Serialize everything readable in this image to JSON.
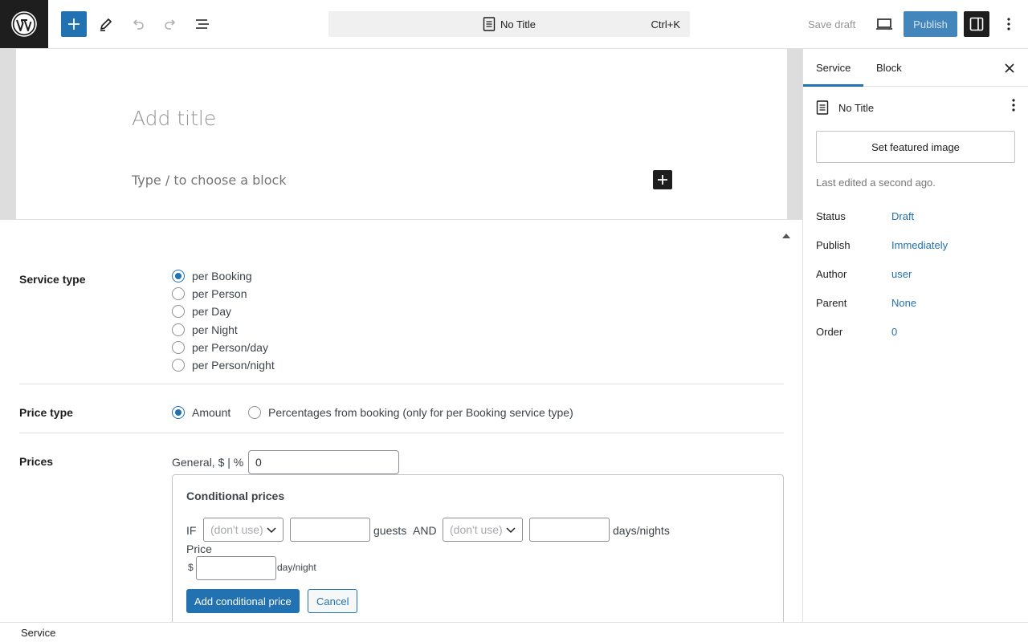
{
  "topbar": {
    "command_title": "No Title",
    "command_shortcut": "Ctrl+K",
    "save_draft": "Save draft",
    "publish": "Publish"
  },
  "editor": {
    "title_placeholder": "Add title",
    "block_placeholder": "Type / to choose a block"
  },
  "meta": {
    "service_type": {
      "label": "Service type",
      "options": [
        "per Booking",
        "per Person",
        "per Day",
        "per Night",
        "per Person/day",
        "per Person/night"
      ],
      "selected": "per Booking"
    },
    "price_type": {
      "label": "Price type",
      "options": [
        "Amount",
        "Percentages from booking (only for per Booking service type)"
      ],
      "selected": "Amount"
    },
    "prices": {
      "label": "Prices",
      "general_label": "General, $ | %",
      "general_value": "0",
      "conditional": {
        "title": "Conditional prices",
        "if_label": "IF",
        "select_1": "(don't use)",
        "guests_label": "guests",
        "and_label": "AND",
        "select_2": "(don't use)",
        "days_label": "days/nights",
        "price_label": "Price",
        "currency": "$",
        "unit_label": "day/night",
        "add_button": "Add conditional price",
        "cancel_button": "Cancel"
      }
    }
  },
  "footer": {
    "breadcrumb": "Service"
  },
  "sidebar": {
    "tabs": [
      "Service",
      "Block"
    ],
    "active_tab": "Service",
    "doc_title": "No Title",
    "featured_image": "Set featured image",
    "last_edited": "Last edited a second ago.",
    "props": [
      {
        "label": "Status",
        "value": "Draft"
      },
      {
        "label": "Publish",
        "value": "Immediately"
      },
      {
        "label": "Author",
        "value": "user"
      },
      {
        "label": "Parent",
        "value": "None"
      },
      {
        "label": "Order",
        "value": "0"
      }
    ]
  },
  "colors": {
    "accent": "#2271b1",
    "dark": "#1e1e1e"
  }
}
